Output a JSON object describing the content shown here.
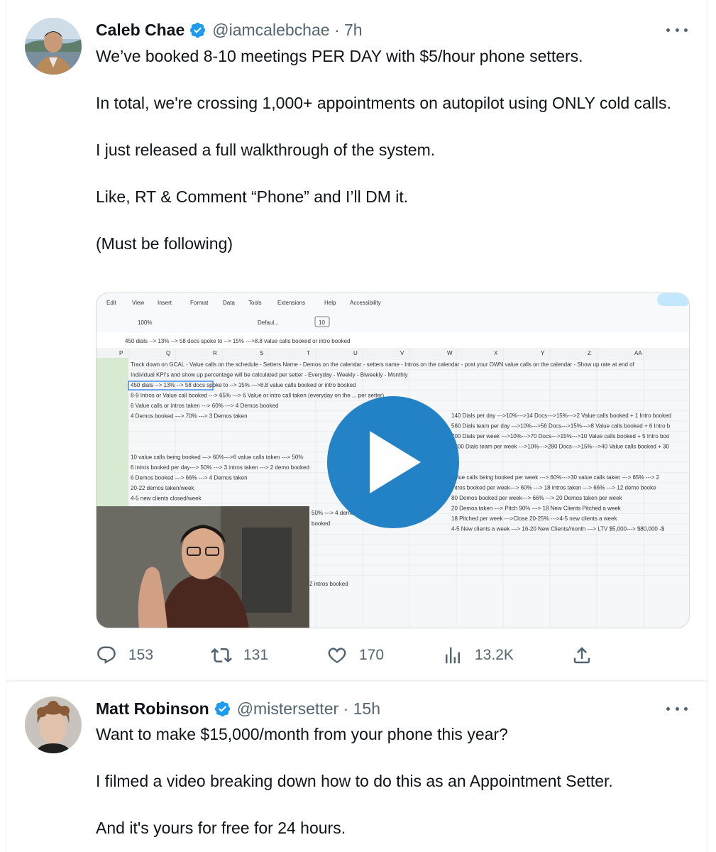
{
  "tweets": [
    {
      "author": {
        "name": "Caleb Chae",
        "handle": "@iamcalebchae",
        "time": "7h",
        "separator": "·",
        "verified": true
      },
      "text": [
        "We’ve booked 8-10 meetings PER DAY with $5/hour phone setters.",
        "In total, we're crossing 1,000+ appointments on autopilot using ONLY cold calls.",
        "I just released a full walkthrough of the system.",
        "Like, RT & Comment “Phone” and I’ll DM it.",
        "(Must be following)"
      ],
      "media": {
        "menu": [
          "Edit",
          "View",
          "Insert",
          "Format",
          "Data",
          "Tools",
          "Extensions",
          "Help",
          "Accessibility"
        ],
        "toolbar": {
          "zoom": "100%",
          "font": "Defaul...",
          "size": "10"
        },
        "formula": "450 dials --> 13% --> 58 docs spoke to --> 15% --->8.8 value calls booked or intro booked",
        "columns": [
          "P",
          "Q",
          "R",
          "S",
          "T",
          "U",
          "V",
          "W",
          "X",
          "Y",
          "Z",
          "AA"
        ],
        "rows_left": [
          "Track down on GCAL - Value calls on the schedule - Setters Name - Demos on the calendar - setters name - Intros on the calendar - post your OWN value calls on the calendar - Show up rate at end of",
          "Individual KPI's and show up percentage will be calculated per setter - Everyday - Weekly - Biweekly - Monthly",
          "450 dials --> 13% --> 58 docs spoke to --> 15% --->8.8 value calls booked or intro booked",
          "8-9 Intros or Value call booked ---> 65% ---> 6 Value or intro call taken (everyday on the ... per setter)",
          "6 Value calls or intros taken ---> 60% ---> 4 Demos booked",
          "4 Demos booked ---> 70% ---> 3 Demos taken",
          "",
          "",
          "",
          "10 value calls being booked ---> 60%--->6 value calls taken ---> 50%",
          "6 intros booked per day---> 50% ---> 3 intros taken ---> 2 demo booked",
          "6 Demos booked ---> 66% ---> 4 Demos taken",
          "20-22 demos taken/week",
          "4-5 new clients closed/week"
        ],
        "rows_right": [
          "140 Dials per day --->10%--->14 Docs--->15%--->2 Value calls booked + 1 Intro booked",
          "560 Dials team per day --->10%--->56 Docs--->15%--->8 Value calls booked + 6 Intro b",
          "700 Dials per week --->10%--->70 Docs--->15%--->10 Value calls booked + 5 Intro boo",
          "2800 Dials team per week --->10%--->280 Docs--->15%--->40 Value calls booked + 30",
          "",
          "",
          "value calls being booked per week ---> 60%--->30 value calls taken ---> 65% ---> 2",
          "intros booked per week---> 60% ---> 18 intros taken ---> 66% ---> 12 demo booke",
          "80 Demos booked per week---> 66% ---> 20 Demos taken per week",
          "20 Demos taken ---> Pitch 90% ---> 18 New Clients Pitched a week",
          "18 Pitched per week --->Close 20-25% --->4-5 new clients a week",
          "4-5 New clients a week ---> 16-20 New Clients/month ---> LTV $5,000---> $80,000 -$"
        ],
        "overlay_cells": [
          "50% ---> 4 demo",
          "booked",
          "2 intros booked"
        ]
      },
      "actions": [
        {
          "icon": "reply-icon",
          "count": "153"
        },
        {
          "icon": "retweet-icon",
          "count": "131"
        },
        {
          "icon": "like-icon",
          "count": "170"
        },
        {
          "icon": "views-icon",
          "count": "13.2K"
        },
        {
          "icon": "share-icon",
          "count": ""
        }
      ]
    },
    {
      "author": {
        "name": "Matt Robinson",
        "handle": "@mistersetter",
        "time": "15h",
        "separator": "·",
        "verified": true
      },
      "text": [
        "Want to make $15,000/month from your phone this year?",
        "I filmed a video breaking down how to do this as an Appointment Setter.",
        "And it's yours for free for 24 hours."
      ]
    }
  ],
  "colors": {
    "verified": "#1d9bf0",
    "secondary_text": "#536471",
    "primary_text": "#0f1419",
    "play_button": "#1d7fc4",
    "border": "#eff3f4"
  }
}
